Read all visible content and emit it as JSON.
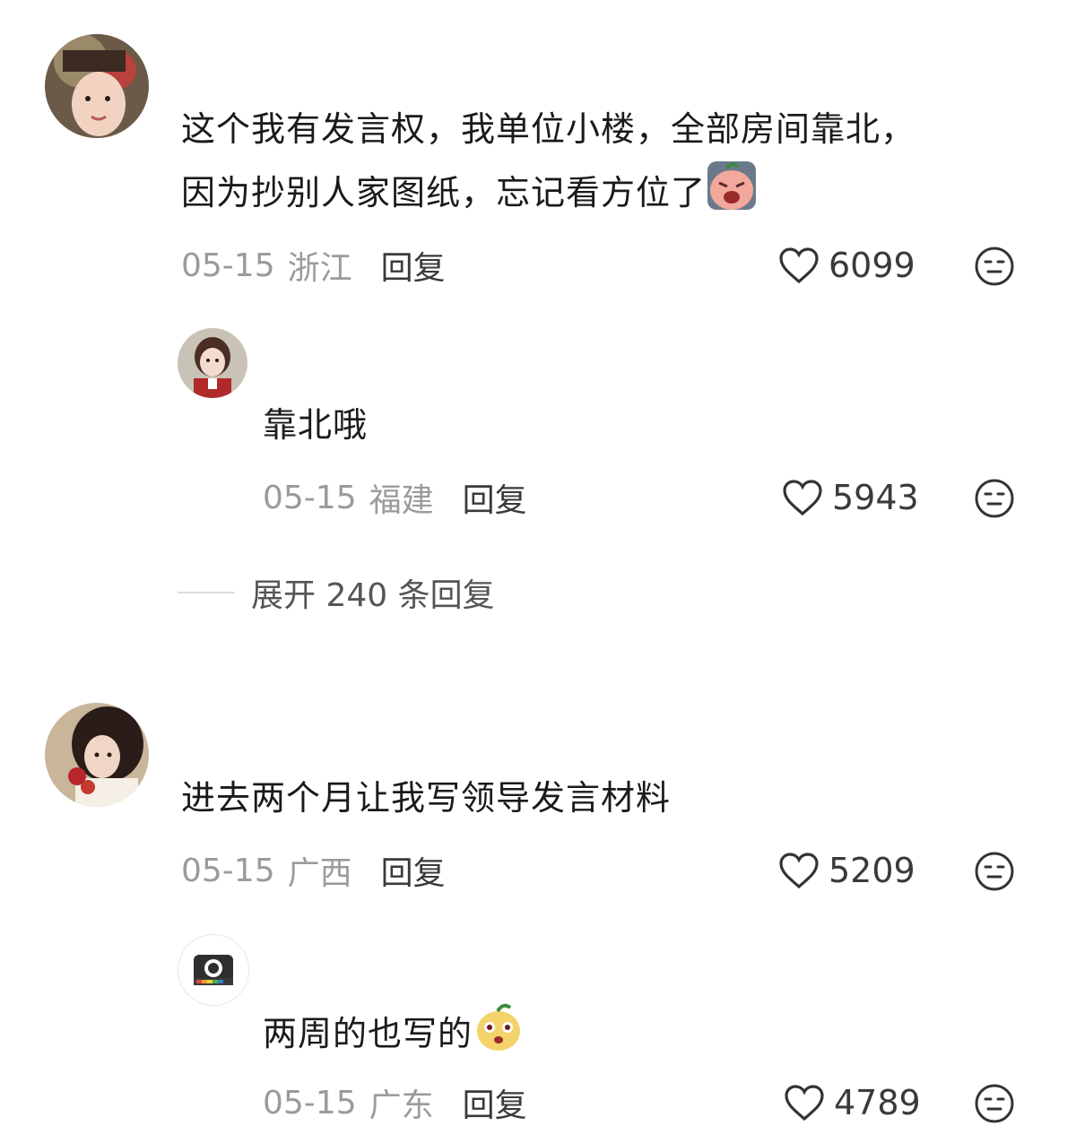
{
  "comments": [
    {
      "text_line1": "这个我有发言权，我单位小楼，全部房间靠北，",
      "text_line2": "因为抄别人家图纸，忘记看方位了",
      "date": "05-15",
      "location": "浙江",
      "reply_label": "回复",
      "likes": "6099",
      "reply": {
        "text": "靠北哦",
        "date": "05-15",
        "location": "福建",
        "reply_label": "回复",
        "likes": "5943"
      },
      "expand_label": "展开 240 条回复"
    },
    {
      "text": "进去两个月让我写领导发言材料",
      "date": "05-15",
      "location": "广西",
      "reply_label": "回复",
      "likes": "5209",
      "reply": {
        "text": "两周的也写的",
        "date": "05-15",
        "location": "广东",
        "reply_label": "回复",
        "likes": "4789"
      }
    }
  ],
  "icons": {
    "like": "heart-outline-icon",
    "more": "face-expression-icon",
    "emoji_1": "crying-peach-emoji",
    "emoji_2": "surprised-pear-emoji"
  }
}
